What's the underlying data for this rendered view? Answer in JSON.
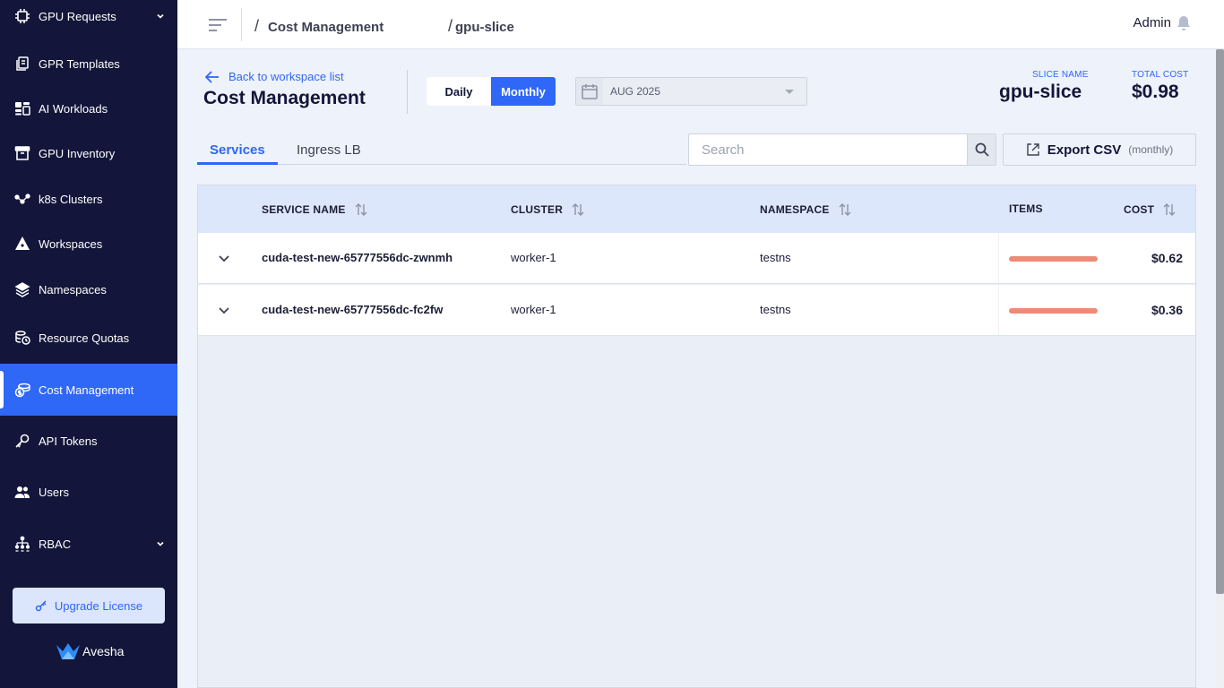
{
  "sidebar": {
    "items": [
      {
        "label": "GPU Requests",
        "icon": "chip-icon",
        "has_chevron": true
      },
      {
        "label": "GPR Templates",
        "icon": "templates-icon"
      },
      {
        "label": "AI Workloads",
        "icon": "workloads-icon"
      },
      {
        "label": "GPU Inventory",
        "icon": "inventory-icon"
      },
      {
        "label": "k8s Clusters",
        "icon": "clusters-icon"
      },
      {
        "label": "Workspaces",
        "icon": "workspaces-icon"
      },
      {
        "label": "Namespaces",
        "icon": "layers-icon"
      },
      {
        "label": "Resource Quotas",
        "icon": "quota-icon"
      },
      {
        "label": "Cost Management",
        "icon": "cost-icon",
        "active": true
      },
      {
        "label": "API Tokens",
        "icon": "key-icon"
      },
      {
        "label": "Users",
        "icon": "users-icon"
      },
      {
        "label": "RBAC",
        "icon": "rbac-icon",
        "has_chevron": true
      }
    ],
    "upgrade_label": "Upgrade License",
    "brand": "Avesha"
  },
  "header": {
    "breadcrumb": [
      "Cost Management",
      "gpu-slice"
    ],
    "user": "Admin"
  },
  "page": {
    "back_link": "Back to workspace list",
    "title": "Cost Management",
    "toggle": {
      "daily": "Daily",
      "monthly": "Monthly",
      "selected": "Monthly"
    },
    "date_value": "AUG 2025",
    "slice_name_label": "SLICE NAME",
    "slice_name": "gpu-slice",
    "total_cost_label": "TOTAL COST",
    "total_cost": "$0.98"
  },
  "tabs": [
    {
      "label": "Services",
      "active": true
    },
    {
      "label": "Ingress LB",
      "active": false
    }
  ],
  "search": {
    "placeholder": "Search",
    "value": ""
  },
  "export": {
    "label": "Export CSV",
    "sub": "(monthly)"
  },
  "table": {
    "columns": [
      "SERVICE NAME",
      "CLUSTER",
      "NAMESPACE",
      "ITEMS",
      "COST"
    ],
    "rows": [
      {
        "service": "cuda-test-new-65777556dc-zwnmh",
        "cluster": "worker-1",
        "namespace": "testns",
        "cost": "$0.62"
      },
      {
        "service": "cuda-test-new-65777556dc-fc2fw",
        "cluster": "worker-1",
        "namespace": "testns",
        "cost": "$0.36"
      }
    ]
  },
  "colors": {
    "sidebar_bg": "#13163a",
    "accent": "#2f67f6",
    "bar": "#ed8b76"
  }
}
